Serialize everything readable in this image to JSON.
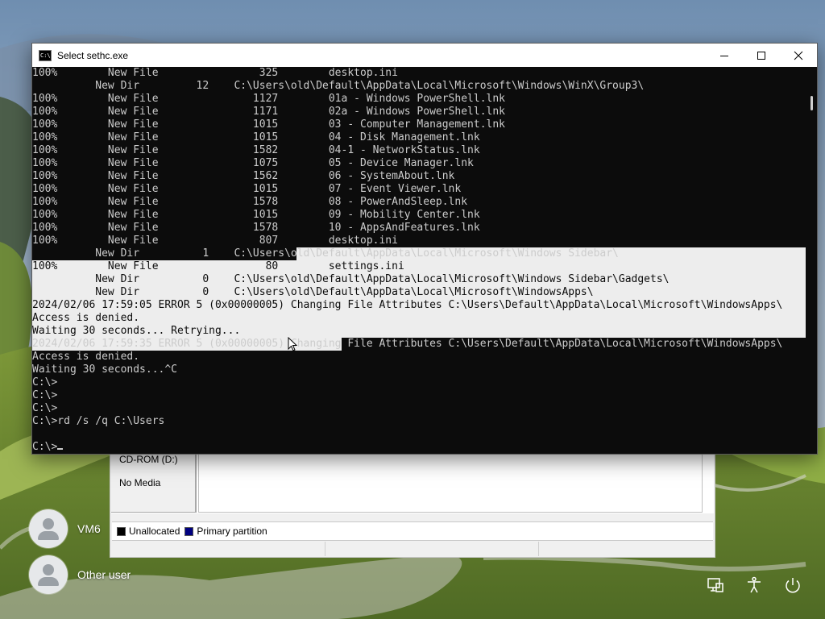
{
  "window": {
    "title": "Select sethc.exe",
    "controls": [
      "minimize-icon",
      "maximize-icon",
      "close-icon"
    ]
  },
  "console": {
    "lines": [
      "100%        New File                325        desktop.ini",
      "          New Dir         12    C:\\Users\\old\\Default\\AppData\\Local\\Microsoft\\Windows\\WinX\\Group3\\",
      "100%        New File               1127        01a - Windows PowerShell.lnk",
      "100%        New File               1171        02a - Windows PowerShell.lnk",
      "100%        New File               1015        03 - Computer Management.lnk",
      "100%        New File               1015        04 - Disk Management.lnk",
      "100%        New File               1582        04-1 - NetworkStatus.lnk",
      "100%        New File               1075        05 - Device Manager.lnk",
      "100%        New File               1562        06 - SystemAbout.lnk",
      "100%        New File               1015        07 - Event Viewer.lnk",
      "100%        New File               1578        08 - PowerAndSleep.lnk",
      "100%        New File               1015        09 - Mobility Center.lnk",
      "100%        New File               1578        10 - AppsAndFeatures.lnk",
      "100%        New File                807        desktop.ini",
      "          New Dir          1    C:\\Users\\old\\Default\\AppData\\Local\\Microsoft\\Windows Sidebar\\",
      "100%        New File                 80        settings.ini",
      "          New Dir          0    C:\\Users\\old\\Default\\AppData\\Local\\Microsoft\\Windows Sidebar\\Gadgets\\",
      "          New Dir          0    C:\\Users\\old\\Default\\AppData\\Local\\Microsoft\\WindowsApps\\",
      "2024/02/06 17:59:05 ERROR 5 (0x00000005) Changing File Attributes C:\\Users\\Default\\AppData\\Local\\Microsoft\\WindowsApps\\",
      "Access is denied.",
      "Waiting 30 seconds... Retrying...",
      "2024/02/06 17:59:35 ERROR 5 (0x00000005) Changing File Attributes C:\\Users\\Default\\AppData\\Local\\Microsoft\\WindowsApps\\",
      "Access is denied.",
      "Waiting 30 seconds...^C",
      "C:\\>",
      "C:\\>",
      "C:\\>",
      "C:\\>rd /s /q C:\\Users",
      "",
      "C:\\>"
    ],
    "colors": {
      "background": "#0c0c0c",
      "text": "#cccccc",
      "selection": "#ededed"
    }
  },
  "disk_management": {
    "drive_label": "CD-ROM (D:)",
    "media_status": "No Media",
    "legend": [
      {
        "label": "Unallocated",
        "color": "#000000"
      },
      {
        "label": "Primary partition",
        "color": "#000080"
      }
    ]
  },
  "users": [
    {
      "name": "VM6"
    },
    {
      "name": "Other user"
    }
  ],
  "system_icons": [
    "network-icon",
    "accessibility-icon",
    "power-icon"
  ]
}
